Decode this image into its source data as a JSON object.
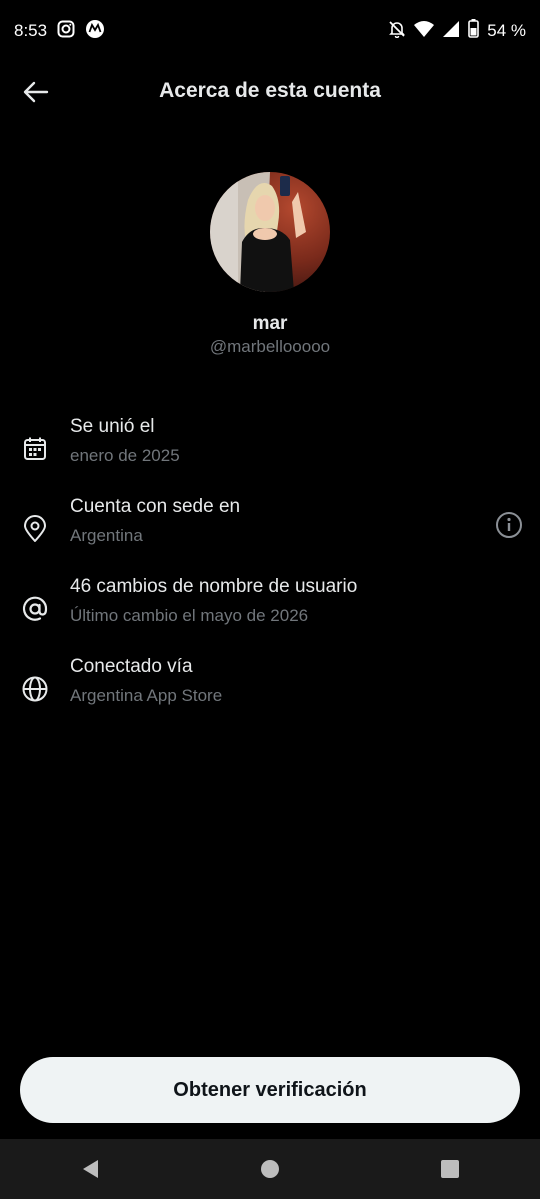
{
  "status_bar": {
    "time": "8:53",
    "left_icons": [
      "instagram-icon",
      "motorola-icon"
    ],
    "right_icons": [
      "bell-off-icon",
      "wifi-icon",
      "signal-icon",
      "battery-icon"
    ],
    "battery": "54 %"
  },
  "header": {
    "back_icon": "arrow-left-icon",
    "title": "Acerca de esta cuenta"
  },
  "profile": {
    "name": "mar",
    "handle": "@marbellooooo"
  },
  "rows": [
    {
      "icon": "calendar-icon",
      "title": "Se unió el",
      "subtitle": "enero de 2025"
    },
    {
      "icon": "location-pin-icon",
      "title": "Cuenta con sede en",
      "subtitle": "Argentina",
      "action_icon": "info-icon"
    },
    {
      "icon": "at-sign-icon",
      "title": "46 cambios de nombre de usuario",
      "subtitle": "Último cambio el mayo de 2026"
    },
    {
      "icon": "globe-icon",
      "title": "Conectado vía",
      "subtitle": "Argentina App Store"
    }
  ],
  "cta": {
    "label": "Obtener verificación"
  },
  "nav": {
    "icons": [
      "back-triangle-icon",
      "home-circle-icon",
      "recents-square-icon"
    ]
  },
  "colors": {
    "background": "#000000",
    "text_primary": "#e7e9ea",
    "text_secondary": "#71767b",
    "button_bg": "#eff3f4"
  }
}
